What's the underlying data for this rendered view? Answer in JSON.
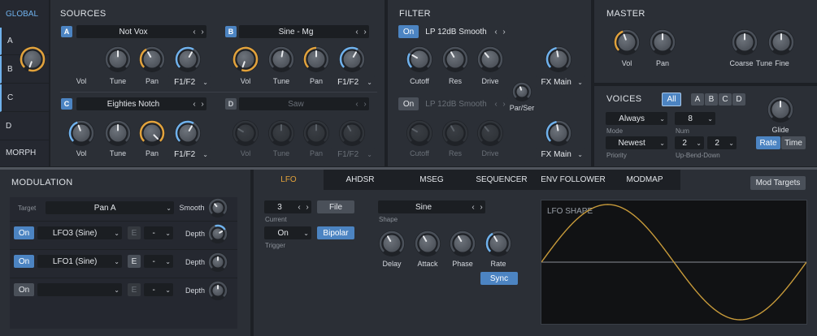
{
  "sidebar": {
    "global": "GLOBAL",
    "items": [
      "A",
      "B",
      "C",
      "D"
    ],
    "morph": "MORPH"
  },
  "sources": {
    "title": "SOURCES",
    "a": {
      "letter": "A",
      "preset": "Not Vox",
      "knobs": [
        "Vol",
        "Tune",
        "Pan"
      ],
      "route": "F1/F2"
    },
    "b": {
      "letter": "B",
      "preset": "Sine - Mg",
      "knobs": [
        "Vol",
        "Tune",
        "Pan"
      ],
      "route": "F1/F2"
    },
    "c": {
      "letter": "C",
      "preset": "Eighties Notch",
      "knobs": [
        "Vol",
        "Tune",
        "Pan"
      ],
      "route": "F1/F2"
    },
    "d": {
      "letter": "D",
      "preset": "Saw",
      "knobs": [
        "Vol",
        "Tune",
        "Pan"
      ],
      "route": "F1/F2"
    }
  },
  "filter": {
    "title": "FILTER",
    "f1": {
      "on": "On",
      "type": "LP 12dB Smooth",
      "knobs": [
        "Cutoff",
        "Res",
        "Drive"
      ],
      "out": "FX Main"
    },
    "f2": {
      "on": "On",
      "type": "LP 12dB Smooth",
      "knobs": [
        "Cutoff",
        "Res",
        "Drive"
      ],
      "out": "FX Main"
    },
    "parser": "Par/Ser"
  },
  "master": {
    "title": "MASTER",
    "knobs": [
      "Vol",
      "Pan",
      "Coarse",
      "Tune",
      "Fine"
    ]
  },
  "voices": {
    "title": "VOICES",
    "all": "All",
    "letters": [
      "A",
      "B",
      "C",
      "D"
    ],
    "mode": "Always",
    "mode_label": "Mode",
    "num": "8",
    "num_label": "Num",
    "priority": "Newest",
    "priority_label": "Priority",
    "up": "2",
    "down": "2",
    "ubd_label": "Up-Bend-Down",
    "glide": "Glide",
    "rate": "Rate",
    "time": "Time"
  },
  "modulation": {
    "title": "MODULATION",
    "target_label": "Target",
    "target": "Pan A",
    "smooth": "Smooth",
    "rows": [
      {
        "on": "On",
        "src": "LFO3 (Sine)",
        "e": "E",
        "sel": "-",
        "depth": "Depth"
      },
      {
        "on": "On",
        "src": "LFO1 (Sine)",
        "e": "E",
        "sel": "-",
        "depth": "Depth"
      },
      {
        "on": "On",
        "src": "",
        "e": "E",
        "sel": "-",
        "depth": "Depth"
      }
    ]
  },
  "tabs": [
    "LFO",
    "AHDSR",
    "MSEG",
    "SEQUENCER",
    "ENV FOLLOWER",
    "MODMAP"
  ],
  "mod_targets": "Mod Targets",
  "lfo": {
    "current": "3",
    "current_label": "Current",
    "file": "File",
    "trigger": "On",
    "trigger_label": "Trigger",
    "bipolar": "Bipolar",
    "shape": "Sine",
    "shape_label": "Shape",
    "knobs": [
      "Delay",
      "Attack",
      "Phase",
      "Rate"
    ],
    "sync": "Sync",
    "display_title": "LFO SHAPE"
  },
  "colors": {
    "accent": "#4c84c2",
    "arc_orange": "#e2a23b",
    "arc_blue": "#6fb1ec",
    "wave": "#c79a3a"
  }
}
